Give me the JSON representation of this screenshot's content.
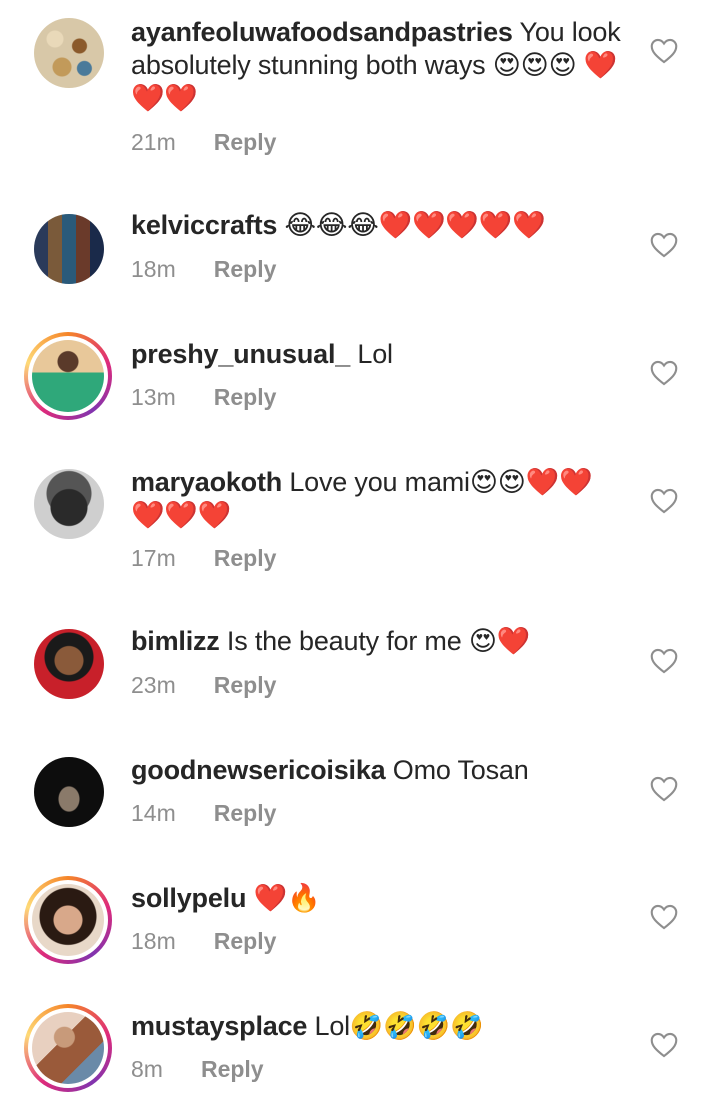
{
  "comments": [
    {
      "username": "ayanfeoluwafoodsandpastries",
      "text": " You look absolutely stunning both ways 😍😍😍 ❤️❤️❤️",
      "time": "21m",
      "reply": "Reply",
      "ring": false,
      "avatar_color": "#c8b89a"
    },
    {
      "username": "kelviccrafts",
      "text": " 😂😂😂❤️❤️❤️❤️❤️",
      "time": "18m",
      "reply": "Reply",
      "ring": false,
      "avatar_color": "#3a4a6a"
    },
    {
      "username": "preshy_unusual_",
      "text": " Lol",
      "time": "13m",
      "reply": "Reply",
      "ring": true,
      "avatar_color": "#d98c6a"
    },
    {
      "username": "maryaokoth",
      "text": " Love you mami😍😍❤️❤️ ❤️❤️❤️",
      "time": "17m",
      "reply": "Reply",
      "ring": false,
      "avatar_color": "#7a7a7a"
    },
    {
      "username": "bimlizz",
      "text": " Is the beauty for me 😍❤️",
      "time": "23m",
      "reply": "Reply",
      "ring": false,
      "avatar_color": "#b2202a"
    },
    {
      "username": "goodnewsericoisika",
      "text": " Omo Tosan",
      "time": "14m",
      "reply": "Reply",
      "ring": false,
      "avatar_color": "#111111"
    },
    {
      "username": "sollypelu",
      "text": " ❤️🔥",
      "time": "18m",
      "reply": "Reply",
      "ring": true,
      "avatar_color": "#5a3a2a"
    },
    {
      "username": "mustaysplace",
      "text": " Lol🤣🤣🤣🤣",
      "time": "8m",
      "reply": "Reply",
      "ring": true,
      "avatar_color": "#9a6a4a"
    }
  ]
}
